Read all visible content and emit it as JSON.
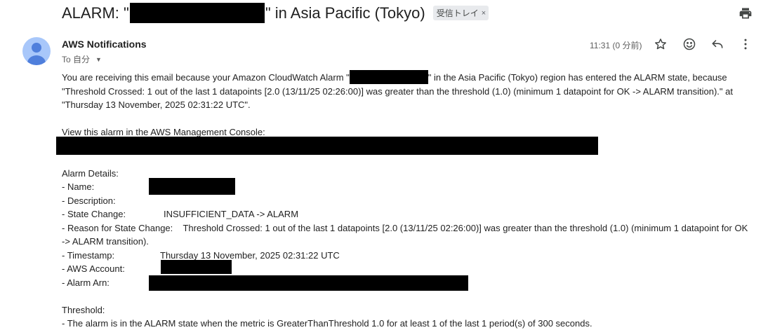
{
  "subject": {
    "prefix": "ALARM: \"",
    "suffix": "\" in Asia Pacific (Tokyo)",
    "label": "受信トレイ",
    "label_remove": "×"
  },
  "toolbar": {
    "print_icon": "print-icon"
  },
  "message": {
    "sender": "AWS Notifications",
    "recipient": "To 自分",
    "time": "11:31 (0 分前)",
    "icons": [
      "star-icon",
      "emoji-icon",
      "reply-icon",
      "more-vert-icon"
    ]
  },
  "body": {
    "intro_1": "You are receiving this email because your Amazon CloudWatch Alarm \"",
    "intro_2": "\" in the Asia Pacific (Tokyo) region has entered the ALARM state, because \"Threshold Crossed: 1 out of the last 1 datapoints [2.0 (13/11/25 02:26:00)] was greater than the threshold (1.0) (minimum 1 datapoint for OK -> ALARM transition).\" at \"Thursday 13 November, 2025 02:31:22 UTC\".",
    "console_text": "View this alarm in the AWS Management Console:",
    "details_heading": "Alarm Details:",
    "name_label": "- Name:",
    "description_label": "- Description:",
    "state_change_label": "- State Change:",
    "state_change_value": "INSUFFICIENT_DATA -> ALARM",
    "reason_label": "- Reason for State Change:",
    "reason_value": "Threshold Crossed: 1 out of the last 1 datapoints [2.0 (13/11/25 02:26:00)] was greater than the threshold (1.0) (minimum 1 datapoint for OK",
    "reason_cont": "-> ALARM transition).",
    "timestamp_label": "- Timestamp:",
    "timestamp_value": "Thursday 13 November, 2025 02:31:22 UTC",
    "account_label": "- AWS Account:",
    "arn_label": "- Alarm Arn:",
    "threshold_heading": "Threshold:",
    "threshold_text": "- The alarm is in the ALARM state when the metric is GreaterThanThreshold 1.0 for at least 1 of the last 1 period(s) of 300 seconds."
  }
}
